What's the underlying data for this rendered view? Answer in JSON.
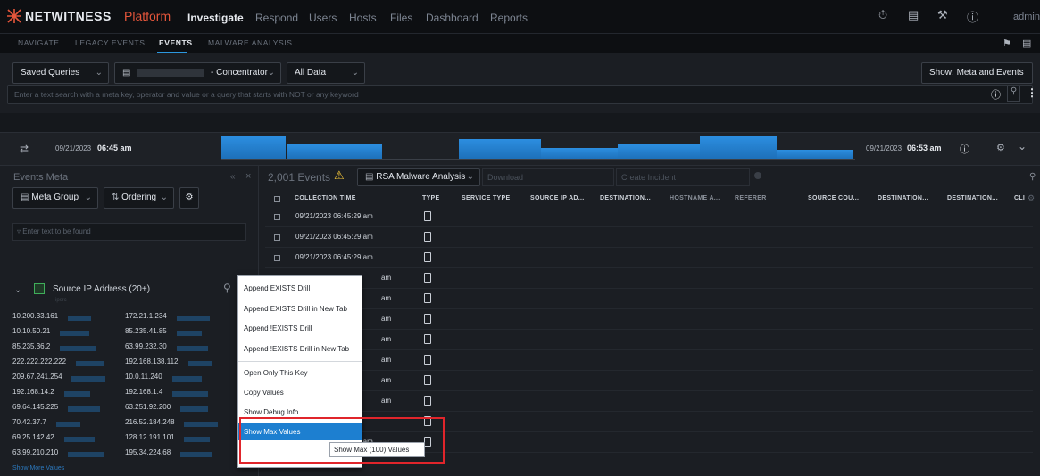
{
  "header": {
    "brand": "NETWITNESS",
    "brand_sub": "Platform",
    "nav": [
      "Investigate",
      "Respond",
      "Users",
      "Hosts",
      "Files",
      "Dashboard",
      "Reports"
    ],
    "active_nav": "Investigate",
    "user": "admin"
  },
  "subnav": {
    "items": [
      "NAVIGATE",
      "LEGACY EVENTS",
      "EVENTS",
      "MALWARE ANALYSIS"
    ],
    "active": "EVENTS"
  },
  "query": {
    "saved_queries": "Saved Queries",
    "service": "- Concentrator",
    "range": "All Data",
    "show_mode": "Show: Meta and Events",
    "placeholder": "Enter a text search with a meta key, operator and value or a query that starts with NOT or any keyword"
  },
  "timeline": {
    "start_date": "09/21/2023",
    "start_time": "06:45 am",
    "end_date": "09/21/2023",
    "end_time": "06:53 am"
  },
  "meta_panel": {
    "title": "Events Meta",
    "group_label": "Meta Group",
    "ordering_label": "Ordering",
    "filter_placeholder": "Enter text to be found",
    "section_title": "Source IP Address (20+)",
    "show_more": "Show More Values",
    "ip_values": [
      [
        "10.200.33.161",
        "172.21.1.234"
      ],
      [
        "10.10.50.21",
        "85.235.41.85"
      ],
      [
        "85.235.36.2",
        "63.99.232.30"
      ],
      [
        "222.222.222.222",
        "192.168.138.112"
      ],
      [
        "209.67.241.254",
        "10.0.11.240"
      ],
      [
        "192.168.14.2",
        "192.168.1.4"
      ],
      [
        "69.64.145.225",
        "63.251.92.200"
      ],
      [
        "70.42.37.7",
        "216.52.184.248"
      ],
      [
        "69.25.142.42",
        "128.12.191.101"
      ],
      [
        "63.99.210.210",
        "195.34.224.68"
      ]
    ]
  },
  "events": {
    "count": "2,001 Events",
    "profile": "RSA Malware Analysis",
    "download": "Download",
    "create_incident": "Create Incident",
    "columns": [
      "COLLECTION TIME",
      "TYPE",
      "SERVICE TYPE",
      "SOURCE IP AD...",
      "DESTINATION...",
      "HOSTNAME A...",
      "REFERER",
      "SOURCE COU...",
      "DESTINATION...",
      "DESTINATION...",
      "CLI"
    ],
    "rows": [
      "09/21/2023 06:45:29 am",
      "09/21/2023 06:45:29 am",
      "09/21/2023 06:45:29 am",
      "am",
      "am",
      "am",
      "am",
      "am",
      "am",
      "am",
      "09/21/2023",
      "09/21/2023 06:45:29 am"
    ]
  },
  "context_menu": {
    "items": [
      "Append EXISTS Drill",
      "Append EXISTS Drill in New Tab",
      "Append !EXISTS Drill",
      "Append !EXISTS Drill in New Tab",
      "Open Only This Key",
      "Copy Values",
      "Show Debug Info",
      "Show Max Values"
    ],
    "tooltip": "Show Max (100) Values"
  }
}
